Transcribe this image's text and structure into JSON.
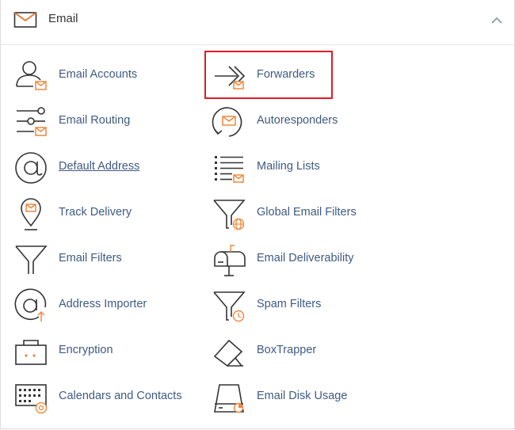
{
  "section": {
    "title": "Email",
    "collapse_icon": "chevron-up-icon",
    "header_icon": "envelope-icon"
  },
  "colors": {
    "label": "#3f5a82",
    "icon_stroke": "#333333",
    "accent": "#f0883e",
    "highlight": "#e01b24"
  },
  "items": [
    {
      "label": "Email Accounts",
      "icon": "email-accounts-icon"
    },
    {
      "label": "Forwarders",
      "icon": "forwarders-icon",
      "highlighted": true
    },
    {
      "label": "Email Routing",
      "icon": "email-routing-icon"
    },
    {
      "label": "Autoresponders",
      "icon": "autoresponders-icon"
    },
    {
      "label": "Default Address",
      "icon": "at-sign-icon"
    },
    {
      "label": "Mailing Lists",
      "icon": "mailing-lists-icon"
    },
    {
      "label": "Track Delivery",
      "icon": "location-pin-icon"
    },
    {
      "label": "Global Email Filters",
      "icon": "global-filter-icon"
    },
    {
      "label": "Email Filters",
      "icon": "filter-funnel-icon"
    },
    {
      "label": "Email Deliverability",
      "icon": "mailbox-icon"
    },
    {
      "label": "Address Importer",
      "icon": "address-importer-icon"
    },
    {
      "label": "Spam Filters",
      "icon": "spam-filter-icon"
    },
    {
      "label": "Encryption",
      "icon": "encryption-icon"
    },
    {
      "label": "BoxTrapper",
      "icon": "boxtrapper-icon"
    },
    {
      "label": "Calendars and Contacts",
      "icon": "calendar-contacts-icon"
    },
    {
      "label": "Email Disk Usage",
      "icon": "disk-usage-icon"
    }
  ]
}
